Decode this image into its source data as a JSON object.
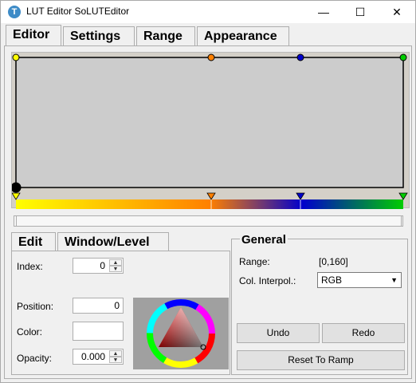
{
  "window": {
    "title": "LUT Editor SoLUTEditor",
    "app_icon": "app-logo-icon",
    "minimize_glyph": "—",
    "maximize_glyph": "☐",
    "close_glyph": "✕"
  },
  "tabs": [
    {
      "label": "Editor",
      "active": true
    },
    {
      "label": "Settings",
      "active": false
    },
    {
      "label": "Range",
      "active": false
    },
    {
      "label": "Appearance",
      "active": false
    }
  ],
  "lut_editor": {
    "background": "#cccccc",
    "control_points": [
      {
        "position": 0,
        "color": "#ffff00"
      },
      {
        "position": 80,
        "color": "#ff8000"
      },
      {
        "position": 119,
        "color": "#0000cc"
      },
      {
        "position": 160,
        "color": "#00cc00"
      }
    ],
    "gradient_stops": [
      "#ffff00",
      "#ff8000",
      "#0000cc",
      "#00cc00"
    ]
  },
  "subtabs": [
    {
      "label": "Edit",
      "active": true
    },
    {
      "label": "Window/Level",
      "active": false
    }
  ],
  "edit": {
    "index_label": "Index:",
    "index_value": "0",
    "position_label": "Position:",
    "position_value": "0",
    "color_label": "Color:",
    "color_value": "#ffffff",
    "opacity_label": "Opacity:",
    "opacity_value": "0.000"
  },
  "general": {
    "title": "General",
    "range_label": "Range:",
    "range_value": "[0,160]",
    "interp_label": "Col. Interpol.:",
    "interp_value": "RGB",
    "undo_label": "Undo",
    "redo_label": "Redo",
    "reset_label": "Reset To Ramp"
  }
}
